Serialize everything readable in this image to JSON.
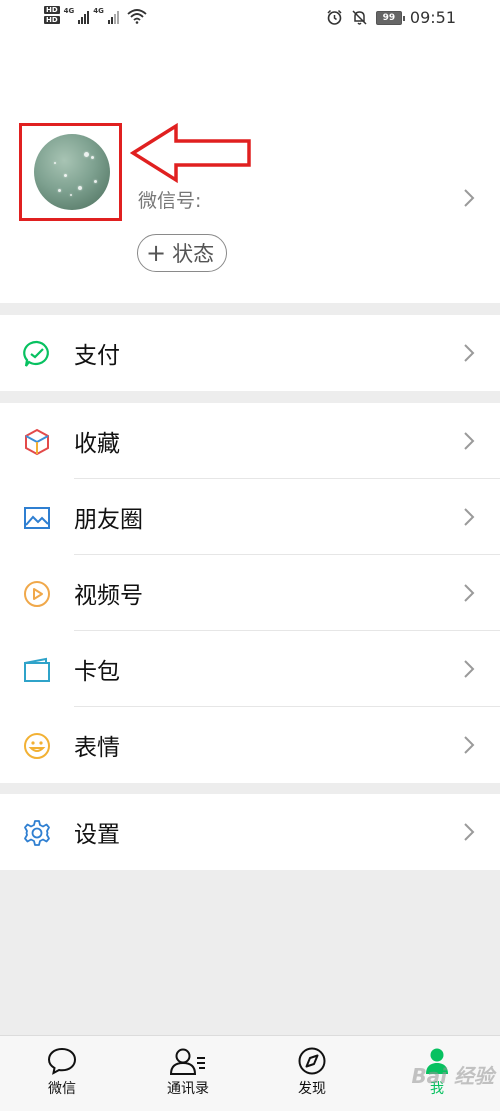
{
  "status_bar": {
    "network_labels": [
      "4G",
      "4G"
    ],
    "battery": "99",
    "time": "09:51"
  },
  "profile": {
    "wechat_id_label": "微信号:",
    "status_button_label": "状态",
    "status_button_plus": "+"
  },
  "menu": {
    "pay": {
      "label": "支付",
      "icon": "pay-icon"
    },
    "favorites": {
      "label": "收藏",
      "icon": "favorites-cube-icon"
    },
    "moments": {
      "label": "朋友圈",
      "icon": "moments-image-icon"
    },
    "channels": {
      "label": "视频号",
      "icon": "channels-play-icon"
    },
    "card_wallet": {
      "label": "卡包",
      "icon": "card-wallet-icon"
    },
    "stickers": {
      "label": "表情",
      "icon": "sticker-smile-icon"
    },
    "settings": {
      "label": "设置",
      "icon": "gear-icon"
    }
  },
  "bottom_nav": {
    "tabs": [
      {
        "label": "微信",
        "icon": "chat-bubble-icon"
      },
      {
        "label": "通讯录",
        "icon": "contacts-icon"
      },
      {
        "label": "发现",
        "icon": "compass-icon"
      },
      {
        "label": "我",
        "icon": "me-person-icon",
        "active": true
      }
    ]
  },
  "watermark": "Bai 经验",
  "colors": {
    "accent_green": "#07c160",
    "annotation_red": "#e02020",
    "background": "#ededed"
  }
}
